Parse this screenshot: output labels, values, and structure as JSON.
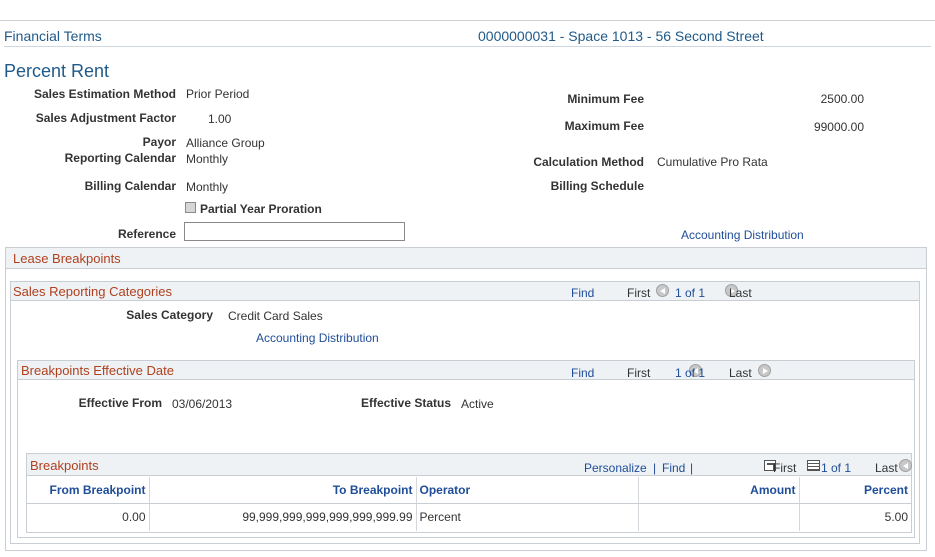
{
  "header": {
    "component": "Financial Terms",
    "lease_info": "0000000031 - Space 1013 - 56 Second Street"
  },
  "page_title": "Percent Rent",
  "fields": {
    "sales_estimation_method": {
      "label": "Sales Estimation Method",
      "value": "Prior Period"
    },
    "sales_adjustment_factor": {
      "label": "Sales Adjustment Factor",
      "value": "1.00"
    },
    "payor": {
      "label": "Payor",
      "value": "Alliance Group"
    },
    "reporting_calendar": {
      "label": "Reporting Calendar",
      "value": "Monthly"
    },
    "billing_calendar": {
      "label": "Billing Calendar",
      "value": "Monthly"
    },
    "partial_year_proration": {
      "label": "Partial Year Proration"
    },
    "reference": {
      "label": "Reference",
      "value": ""
    },
    "minimum_fee": {
      "label": "Minimum Fee",
      "value": "2500.00"
    },
    "maximum_fee": {
      "label": "Maximum Fee",
      "value": "99000.00"
    },
    "calculation_method": {
      "label": "Calculation Method",
      "value": "Cumulative Pro Rata"
    },
    "billing_schedule": {
      "label": "Billing Schedule",
      "value": ""
    },
    "accounting_distribution": "Accounting Distribution"
  },
  "lease_breakpoints": {
    "title": "Lease Breakpoints"
  },
  "sales_reporting": {
    "title": "Sales Reporting Categories",
    "find": "Find",
    "first": "First",
    "count": "1 of 1",
    "last": "Last",
    "category_label": "Sales Category",
    "category_value": "Credit Card Sales",
    "accounting_distribution": "Accounting Distribution"
  },
  "effective_date": {
    "title": "Breakpoints Effective Date",
    "find": "Find",
    "first": "First",
    "count": "1 of 1",
    "last": "Last",
    "effective_from_label": "Effective From",
    "effective_from_value": "03/06/2013",
    "effective_status_label": "Effective Status",
    "effective_status_value": "Active"
  },
  "breakpoints": {
    "title": "Breakpoints",
    "personalize": "Personalize",
    "sep1": "|",
    "find": "Find",
    "sep2": "|",
    "first": "First",
    "count": "1 of 1",
    "last": "Last",
    "columns": [
      "From Breakpoint",
      "To Breakpoint",
      "Operator",
      "Amount",
      "Percent"
    ],
    "rows": [
      [
        "0.00",
        "99,999,999,999,999,999,999.99",
        "Percent",
        "",
        "5.00"
      ]
    ]
  },
  "icons": {
    "prev": "chevron-left-icon",
    "next": "chevron-right-icon",
    "view_all": "new-window-icon",
    "download": "spreadsheet-icon",
    "checkbox": "checkbox-icon"
  }
}
